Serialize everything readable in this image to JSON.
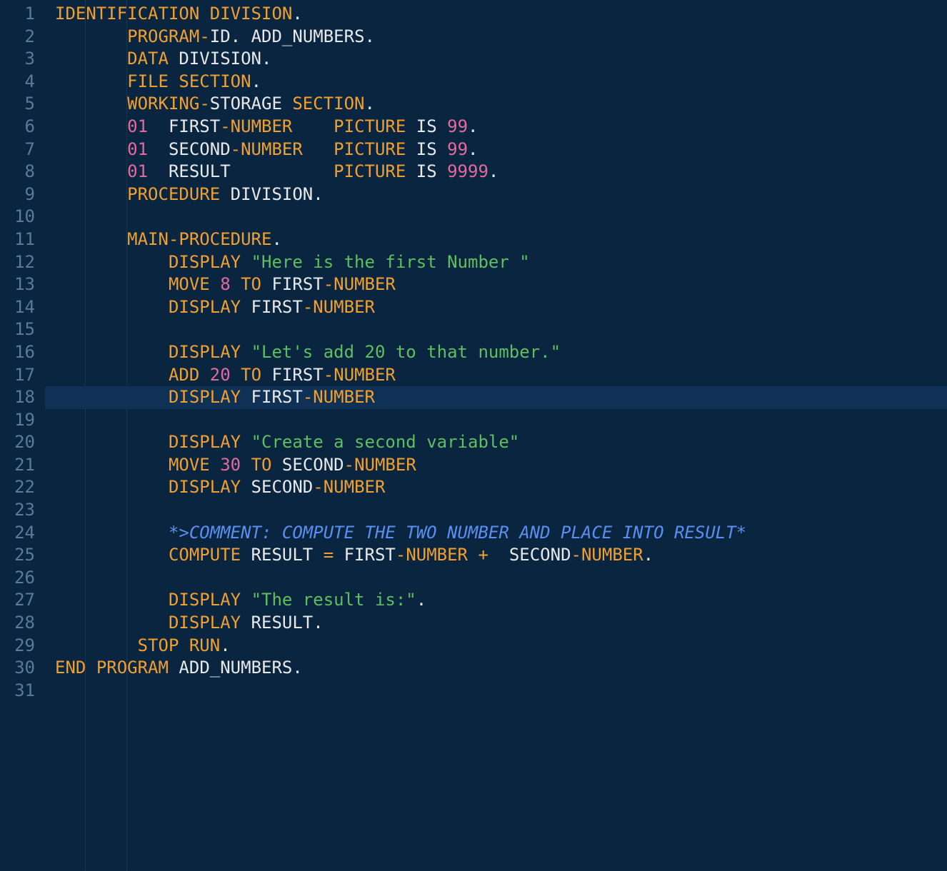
{
  "line_count": 31,
  "highlighted_line": 18,
  "lines": [
    [
      {
        "cls": "kw",
        "t": "IDENTIFICATION"
      },
      {
        "cls": "id",
        "t": " "
      },
      {
        "cls": "kw",
        "t": "DIVISION"
      },
      {
        "cls": "punct",
        "t": "."
      }
    ],
    [
      {
        "cls": "id",
        "t": "       "
      },
      {
        "cls": "kw",
        "t": "PROGRAM"
      },
      {
        "cls": "op",
        "t": "-"
      },
      {
        "cls": "id",
        "t": "ID"
      },
      {
        "cls": "punct",
        "t": ". "
      },
      {
        "cls": "id",
        "t": "ADD_NUMBERS"
      },
      {
        "cls": "punct",
        "t": "."
      }
    ],
    [
      {
        "cls": "id",
        "t": "       "
      },
      {
        "cls": "kw",
        "t": "DATA"
      },
      {
        "cls": "id",
        "t": " DIVISION"
      },
      {
        "cls": "punct",
        "t": "."
      }
    ],
    [
      {
        "cls": "id",
        "t": "       "
      },
      {
        "cls": "kw",
        "t": "FILE"
      },
      {
        "cls": "id",
        "t": " "
      },
      {
        "cls": "kw",
        "t": "SECTION"
      },
      {
        "cls": "punct",
        "t": "."
      }
    ],
    [
      {
        "cls": "id",
        "t": "       "
      },
      {
        "cls": "kw",
        "t": "WORKING"
      },
      {
        "cls": "op",
        "t": "-"
      },
      {
        "cls": "id",
        "t": "STORAGE "
      },
      {
        "cls": "kw",
        "t": "SECTION"
      },
      {
        "cls": "punct",
        "t": "."
      }
    ],
    [
      {
        "cls": "id",
        "t": "       "
      },
      {
        "cls": "num",
        "t": "01"
      },
      {
        "cls": "id",
        "t": "  FIRST"
      },
      {
        "cls": "op",
        "t": "-"
      },
      {
        "cls": "kw",
        "t": "NUMBER"
      },
      {
        "cls": "id",
        "t": "    "
      },
      {
        "cls": "kw",
        "t": "PICTURE"
      },
      {
        "cls": "id",
        "t": " IS "
      },
      {
        "cls": "num",
        "t": "99"
      },
      {
        "cls": "punct",
        "t": "."
      }
    ],
    [
      {
        "cls": "id",
        "t": "       "
      },
      {
        "cls": "num",
        "t": "01"
      },
      {
        "cls": "id",
        "t": "  SECOND"
      },
      {
        "cls": "op",
        "t": "-"
      },
      {
        "cls": "kw",
        "t": "NUMBER"
      },
      {
        "cls": "id",
        "t": "   "
      },
      {
        "cls": "kw",
        "t": "PICTURE"
      },
      {
        "cls": "id",
        "t": " IS "
      },
      {
        "cls": "num",
        "t": "99"
      },
      {
        "cls": "punct",
        "t": "."
      }
    ],
    [
      {
        "cls": "id",
        "t": "       "
      },
      {
        "cls": "num",
        "t": "01"
      },
      {
        "cls": "id",
        "t": "  RESULT          "
      },
      {
        "cls": "kw",
        "t": "PICTURE"
      },
      {
        "cls": "id",
        "t": " IS "
      },
      {
        "cls": "num",
        "t": "9999"
      },
      {
        "cls": "punct",
        "t": "."
      }
    ],
    [
      {
        "cls": "id",
        "t": "       "
      },
      {
        "cls": "kw",
        "t": "PROCEDURE"
      },
      {
        "cls": "id",
        "t": " DIVISION"
      },
      {
        "cls": "punct",
        "t": "."
      }
    ],
    [],
    [
      {
        "cls": "id",
        "t": "       "
      },
      {
        "cls": "kw",
        "t": "MAIN"
      },
      {
        "cls": "op",
        "t": "-"
      },
      {
        "cls": "kw",
        "t": "PROCEDURE"
      },
      {
        "cls": "punct",
        "t": "."
      }
    ],
    [
      {
        "cls": "id",
        "t": "           "
      },
      {
        "cls": "kw",
        "t": "DISPLAY"
      },
      {
        "cls": "id",
        "t": " "
      },
      {
        "cls": "str",
        "t": "\"Here is the first Number \""
      }
    ],
    [
      {
        "cls": "id",
        "t": "           "
      },
      {
        "cls": "kw",
        "t": "MOVE"
      },
      {
        "cls": "id",
        "t": " "
      },
      {
        "cls": "num",
        "t": "8"
      },
      {
        "cls": "id",
        "t": " "
      },
      {
        "cls": "kw",
        "t": "TO"
      },
      {
        "cls": "id",
        "t": " FIRST"
      },
      {
        "cls": "op",
        "t": "-"
      },
      {
        "cls": "kw",
        "t": "NUMBER"
      }
    ],
    [
      {
        "cls": "id",
        "t": "           "
      },
      {
        "cls": "kw",
        "t": "DISPLAY"
      },
      {
        "cls": "id",
        "t": " FIRST"
      },
      {
        "cls": "op",
        "t": "-"
      },
      {
        "cls": "kw",
        "t": "NUMBER"
      }
    ],
    [],
    [
      {
        "cls": "id",
        "t": "           "
      },
      {
        "cls": "kw",
        "t": "DISPLAY"
      },
      {
        "cls": "id",
        "t": " "
      },
      {
        "cls": "str",
        "t": "\"Let's add 20 to that number.\""
      }
    ],
    [
      {
        "cls": "id",
        "t": "           "
      },
      {
        "cls": "kw",
        "t": "ADD"
      },
      {
        "cls": "id",
        "t": " "
      },
      {
        "cls": "num",
        "t": "20"
      },
      {
        "cls": "id",
        "t": " "
      },
      {
        "cls": "kw",
        "t": "TO"
      },
      {
        "cls": "id",
        "t": " FIRST"
      },
      {
        "cls": "op",
        "t": "-"
      },
      {
        "cls": "kw",
        "t": "NUMBER"
      }
    ],
    [
      {
        "cls": "id",
        "t": "           "
      },
      {
        "cls": "kw",
        "t": "DISPLAY"
      },
      {
        "cls": "id",
        "t": " FIRST"
      },
      {
        "cls": "op",
        "t": "-"
      },
      {
        "cls": "kw",
        "t": "NUMBER"
      }
    ],
    [],
    [
      {
        "cls": "id",
        "t": "           "
      },
      {
        "cls": "kw",
        "t": "DISPLAY"
      },
      {
        "cls": "id",
        "t": " "
      },
      {
        "cls": "str",
        "t": "\"Create a second variable\""
      }
    ],
    [
      {
        "cls": "id",
        "t": "           "
      },
      {
        "cls": "kw",
        "t": "MOVE"
      },
      {
        "cls": "id",
        "t": " "
      },
      {
        "cls": "num",
        "t": "30"
      },
      {
        "cls": "id",
        "t": " "
      },
      {
        "cls": "kw",
        "t": "TO"
      },
      {
        "cls": "id",
        "t": " SECOND"
      },
      {
        "cls": "op",
        "t": "-"
      },
      {
        "cls": "kw",
        "t": "NUMBER"
      }
    ],
    [
      {
        "cls": "id",
        "t": "           "
      },
      {
        "cls": "kw",
        "t": "DISPLAY"
      },
      {
        "cls": "id",
        "t": " SECOND"
      },
      {
        "cls": "op",
        "t": "-"
      },
      {
        "cls": "kw",
        "t": "NUMBER"
      }
    ],
    [],
    [
      {
        "cls": "id",
        "t": "           "
      },
      {
        "cls": "cmt",
        "t": "*>COMMENT: COMPUTE THE TWO NUMBER AND PLACE INTO RESULT*"
      }
    ],
    [
      {
        "cls": "id",
        "t": "           "
      },
      {
        "cls": "kw",
        "t": "COMPUTE"
      },
      {
        "cls": "id",
        "t": " RESULT "
      },
      {
        "cls": "op",
        "t": "="
      },
      {
        "cls": "id",
        "t": " FIRST"
      },
      {
        "cls": "op",
        "t": "-"
      },
      {
        "cls": "kw",
        "t": "NUMBER"
      },
      {
        "cls": "id",
        "t": " "
      },
      {
        "cls": "op",
        "t": "+"
      },
      {
        "cls": "id",
        "t": "  SECOND"
      },
      {
        "cls": "op",
        "t": "-"
      },
      {
        "cls": "kw",
        "t": "NUMBER"
      },
      {
        "cls": "punct",
        "t": "."
      }
    ],
    [],
    [
      {
        "cls": "id",
        "t": "           "
      },
      {
        "cls": "kw",
        "t": "DISPLAY"
      },
      {
        "cls": "id",
        "t": " "
      },
      {
        "cls": "str",
        "t": "\"The result is:\""
      },
      {
        "cls": "punct",
        "t": "."
      }
    ],
    [
      {
        "cls": "id",
        "t": "           "
      },
      {
        "cls": "kw",
        "t": "DISPLAY"
      },
      {
        "cls": "id",
        "t": " RESULT"
      },
      {
        "cls": "punct",
        "t": "."
      }
    ],
    [
      {
        "cls": "id",
        "t": "        "
      },
      {
        "cls": "kw",
        "t": "STOP"
      },
      {
        "cls": "id",
        "t": " "
      },
      {
        "cls": "kw",
        "t": "RUN"
      },
      {
        "cls": "punct",
        "t": "."
      }
    ],
    [
      {
        "cls": "kw",
        "t": "END"
      },
      {
        "cls": "id",
        "t": " "
      },
      {
        "cls": "kw",
        "t": "PROGRAM"
      },
      {
        "cls": "id",
        "t": " ADD_NUMBERS"
      },
      {
        "cls": "punct",
        "t": "."
      }
    ],
    []
  ],
  "indent_guides": [
    56,
    114
  ]
}
